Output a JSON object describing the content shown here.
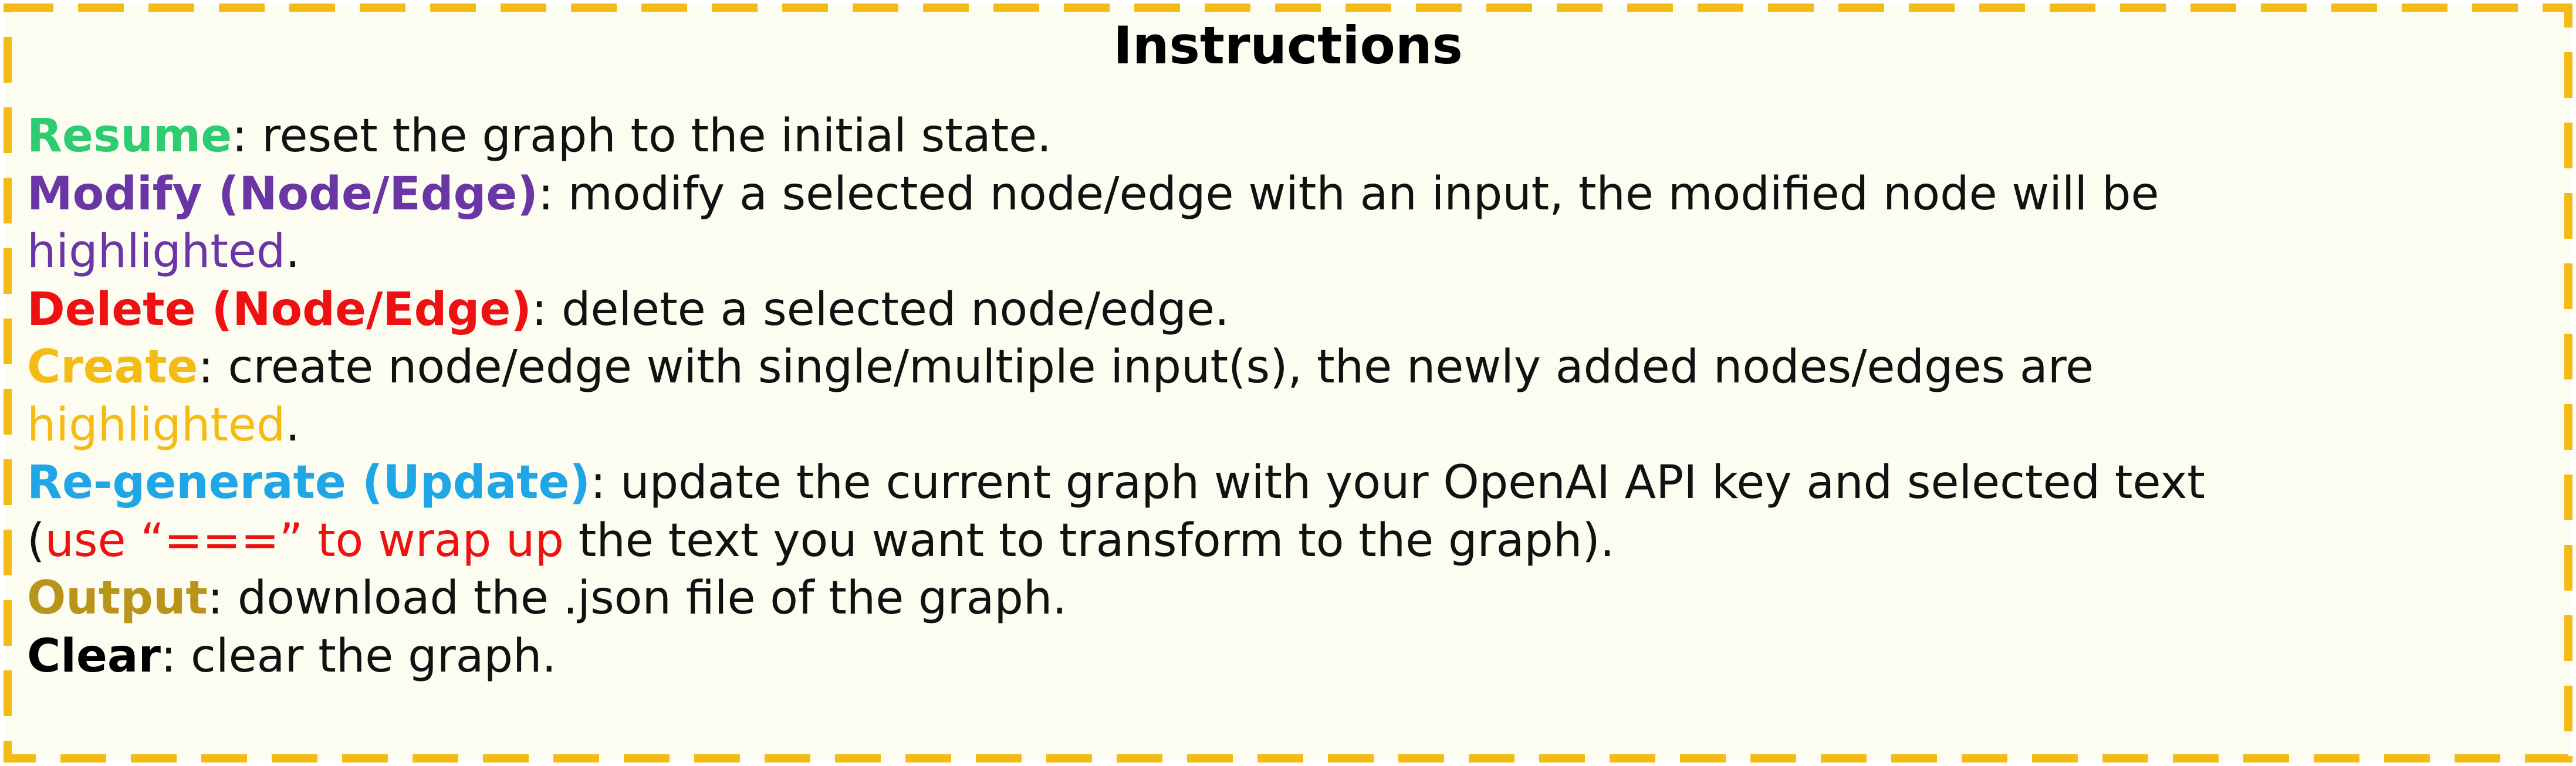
{
  "title": "Instructions",
  "colors": {
    "border": "#f5bb15",
    "background": "#fcfcf1",
    "resume": "#2ecc71",
    "modify": "#6a35a5",
    "delete": "#ee1111",
    "create": "#f5bb15",
    "regenerate": "#1fa6e6",
    "output": "#b8941a",
    "clear": "#000000"
  },
  "items": {
    "resume": {
      "keyword": "Resume",
      "text": ": reset the graph to the initial state."
    },
    "modify": {
      "keyword": "Modify (Node/Edge)",
      "text": ": modify a selected node/edge with an input, the modified node will be",
      "highlight": "highlighted",
      "end": "."
    },
    "delete": {
      "keyword": "Delete (Node/Edge)",
      "text": ": delete a selected node/edge."
    },
    "create": {
      "keyword": "Create",
      "text": ": create node/edge with single/multiple input(s), the newly added nodes/edges are",
      "highlight": "highlighted",
      "end": "."
    },
    "regenerate": {
      "keyword": "Re-generate (Update)",
      "text": ": update the current graph with your OpenAI API key and selected text",
      "open_paren": "(",
      "wrap_note": "use “===” to wrap up",
      "text2": " the text you want to transform to the graph)."
    },
    "output": {
      "keyword": "Output",
      "text": ": download the .json file of the graph."
    },
    "clear": {
      "keyword": "Clear",
      "text": ": clear the graph."
    }
  }
}
